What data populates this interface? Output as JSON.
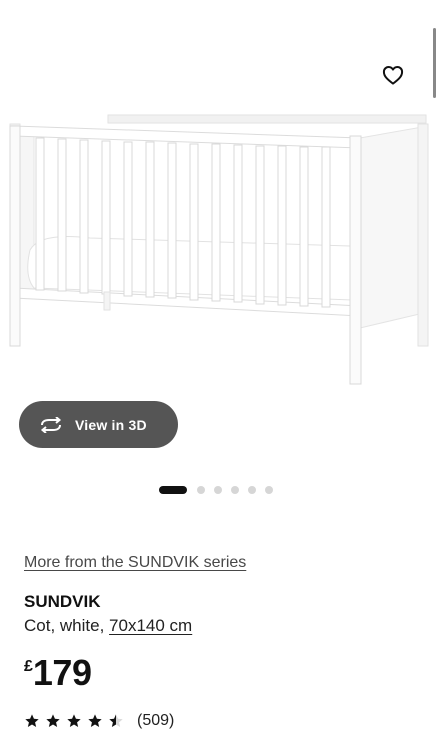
{
  "hero": {
    "favourite_icon": "heart-outline-icon",
    "scrollbar": true
  },
  "view3d": {
    "icon": "rotate-arrows-icon",
    "label": "View in 3D"
  },
  "carousel": {
    "total": 6,
    "active_index": 0
  },
  "product": {
    "series_link": "More from the SUNDVIK series",
    "name": "SUNDVIK",
    "description": "Cot, white, ",
    "size": "70x140 cm",
    "currency": "£",
    "price": "179",
    "rating": {
      "stars": 4.5,
      "max": 5,
      "count": "(509)"
    }
  },
  "colors": {
    "button_bg": "#555555",
    "dot_active": "#111111",
    "dot_inactive": "#d6d6d6"
  }
}
